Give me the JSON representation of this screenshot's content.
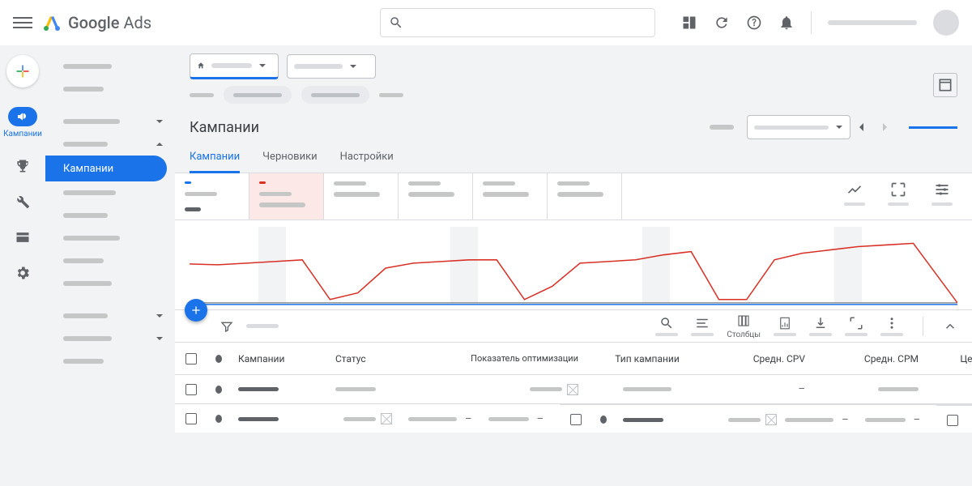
{
  "header": {
    "product_name_bold": "Google",
    "product_name": "Ads"
  },
  "rail": {
    "campaigns_label": "Кампании"
  },
  "sidebar": {
    "active_label": "Кампании"
  },
  "page": {
    "title": "Кампании"
  },
  "tabs": {
    "campaigns": "Кампании",
    "drafts": "Черновики",
    "settings": "Настройки"
  },
  "toolbar": {
    "columns_label": "Столбцы"
  },
  "table": {
    "headers": {
      "campaign": "Кампании",
      "status": "Статус",
      "optimization": "Показатель оптимизации",
      "type": "Тип кампании",
      "cpv": "Средн. CPV",
      "cpm": "Средн. CPM",
      "price": "Цена"
    },
    "dash": "–"
  },
  "chart_data": {
    "type": "line",
    "series": [
      {
        "name": "metric-red",
        "color": "#d93025",
        "values": [
          45,
          46,
          44,
          42,
          40,
          88,
          80,
          50,
          44,
          42,
          40,
          40,
          88,
          72,
          44,
          42,
          40,
          34,
          30,
          88,
          88,
          40,
          32,
          28,
          24,
          22,
          20,
          92
        ]
      },
      {
        "name": "metric-blue",
        "color": "#1a73e8",
        "values": [
          94,
          94,
          94,
          94,
          94,
          94,
          94,
          94,
          94,
          94,
          94,
          94,
          94,
          94,
          94,
          94,
          94,
          94,
          94,
          94,
          94,
          94,
          94,
          94,
          94,
          94,
          94,
          94
        ]
      }
    ],
    "weekend_bands": [
      [
        2.5,
        3.5
      ],
      [
        9.5,
        10.5
      ],
      [
        16.5,
        17.5
      ],
      [
        23.5,
        24.5
      ]
    ],
    "ylim": [
      0,
      100
    ]
  }
}
